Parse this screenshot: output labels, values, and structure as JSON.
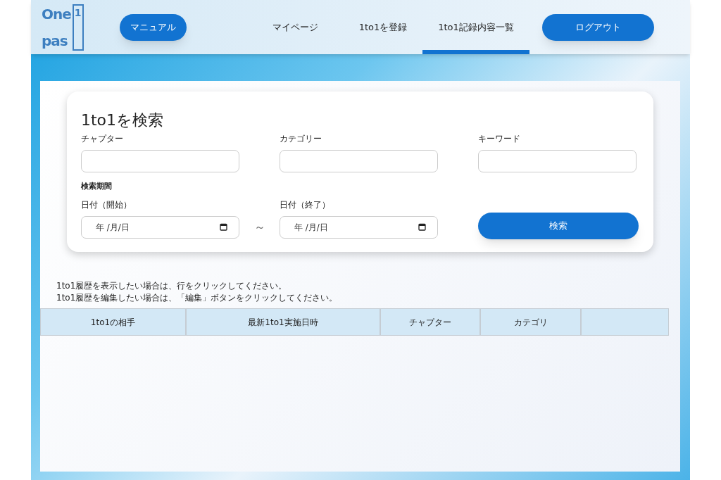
{
  "header": {
    "logo": {
      "line_1": "One",
      "line_2": "pas",
      "mark": "1"
    },
    "manual_button": "マニュアル",
    "nav": [
      {
        "label": "マイページ",
        "selected": false
      },
      {
        "label": "1to1を登録",
        "selected": false
      },
      {
        "label": "1to1記録内容一覧",
        "selected": true
      }
    ],
    "logout_button": "ログアウト"
  },
  "search_card": {
    "title": "1to1を検索",
    "fields": [
      {
        "label": "チャプター"
      },
      {
        "label": "カテゴリー"
      },
      {
        "label": "キーワード"
      }
    ],
    "period_label": "検索期間",
    "start_date": {
      "label": "日付（開始）",
      "placeholder": "年 /月/日"
    },
    "separator": "～",
    "end_date": {
      "label": "日付（終了）",
      "placeholder": "年 /月/日"
    },
    "search_button": "検索"
  },
  "instructions": [
    "1to1履歴を表示したい場合は、行をクリックしてください。",
    "1to1履歴を編集したい場合は、「編集」ボタンをクリックしてください。"
  ],
  "table": {
    "columns": [
      "1to1の相手",
      "最新1to1実施日時",
      "チャプター",
      "カテゴリ"
    ]
  }
}
